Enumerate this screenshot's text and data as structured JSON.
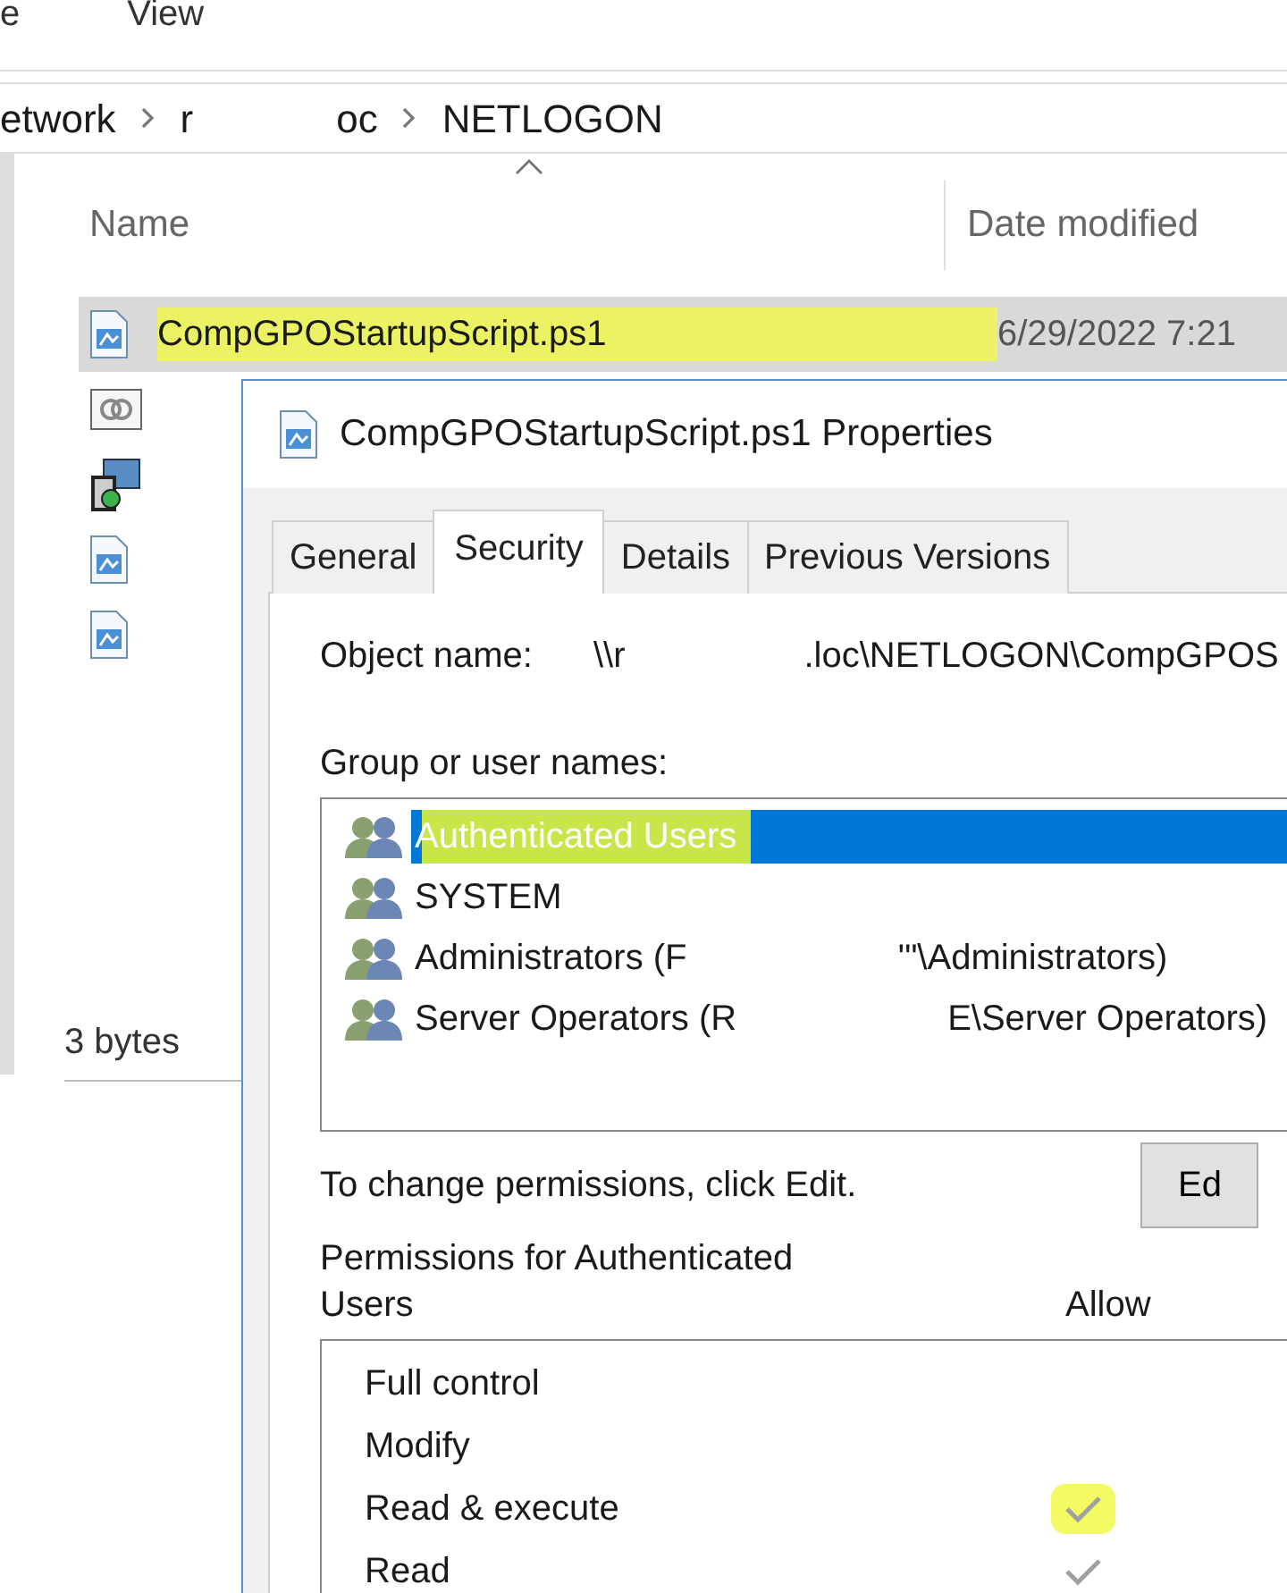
{
  "explorer": {
    "menu": [
      "e",
      "View"
    ],
    "address": [
      {
        "parts": [
          "etwork"
        ]
      },
      {
        "parts": [
          "r",
          "oc"
        ]
      },
      {
        "parts": [
          "NETLOGON"
        ]
      }
    ],
    "columns": [
      {
        "label": "Name",
        "sorted": true
      },
      {
        "label": "Date modified",
        "sorted": false
      }
    ],
    "files": [
      {
        "kind": "script",
        "name": "CompGPOStartupScript.ps1",
        "date": "6/29/2022 7:21",
        "selected": true,
        "highlighted": true
      },
      {
        "kind": "link",
        "selected": false
      },
      {
        "kind": "installer",
        "selected": false
      },
      {
        "kind": "script",
        "selected": false
      },
      {
        "kind": "script",
        "selected": false
      }
    ],
    "status": "3 bytes"
  },
  "dialog": {
    "title": "CompGPOStartupScript.ps1 Properties",
    "tabs": [
      {
        "label": "General",
        "selected": false
      },
      {
        "label": "Security",
        "selected": true
      },
      {
        "label": "Details",
        "selected": false
      },
      {
        "label": "Previous Versions",
        "selected": false
      }
    ],
    "object_name_label": "Object name:",
    "object_name": [
      "\\\\r",
      ".loc\\NETLOGON\\CompGPOS"
    ],
    "groups_label": "Group or user names:",
    "groups": [
      {
        "parts": [
          "Authenticated Users"
        ],
        "selected": true,
        "highlighted": true
      },
      {
        "parts": [
          "SYSTEM"
        ],
        "selected": false,
        "highlighted": false
      },
      {
        "parts": [
          "Administrators (F",
          "'\"\\Administrators)"
        ],
        "selected": false,
        "highlighted": false
      },
      {
        "parts": [
          "Server Operators (R",
          "E\\Server Operators)"
        ],
        "selected": false,
        "highlighted": false
      }
    ],
    "change_hint": "To change permissions, click Edit.",
    "edit_button": "Ed",
    "permissions_label": "Permissions for Authenticated Users",
    "allow_label": "Allow",
    "permissions": [
      {
        "name": "Full control",
        "allow": false,
        "highlighted": false
      },
      {
        "name": "Modify",
        "allow": false,
        "highlighted": false
      },
      {
        "name": "Read & execute",
        "allow": true,
        "highlighted": true
      },
      {
        "name": "Read",
        "allow": true,
        "highlighted": false
      }
    ]
  }
}
